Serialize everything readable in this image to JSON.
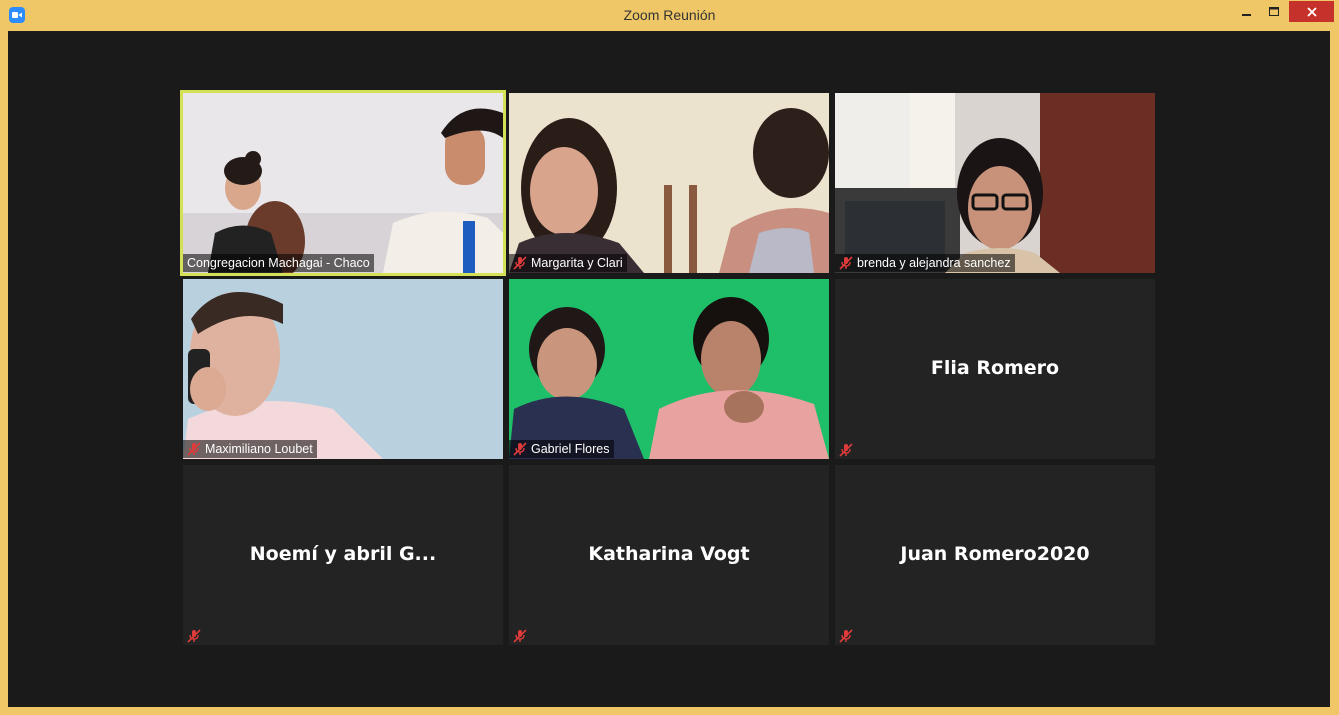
{
  "window": {
    "title": "Zoom Reunión"
  },
  "icons": {
    "app": "zoom-camera-icon",
    "muted": "microphone-muted-icon"
  },
  "colors": {
    "window_frame": "#f0c766",
    "meeting_background": "#1a1a1a",
    "tile_background": "#232323",
    "active_speaker_border": "#d4e157",
    "mute_icon": "#e03b3b"
  },
  "participants": [
    {
      "name": "Congregacion Machagai - Chaco",
      "muted": false,
      "video": true,
      "active_speaker": true
    },
    {
      "name": "Margarita y Clari",
      "muted": true,
      "video": true,
      "active_speaker": false
    },
    {
      "name": "brenda y alejandra sanchez",
      "muted": true,
      "video": true,
      "active_speaker": false
    },
    {
      "name": "Maximiliano Loubet",
      "muted": true,
      "video": true,
      "active_speaker": false
    },
    {
      "name": "Gabriel Flores",
      "muted": true,
      "video": true,
      "active_speaker": false
    },
    {
      "name": "Flia Romero",
      "muted": true,
      "video": false,
      "active_speaker": false
    },
    {
      "name": "Noemí y abril G...",
      "muted": true,
      "video": false,
      "active_speaker": false
    },
    {
      "name": "Katharina Vogt",
      "muted": true,
      "video": false,
      "active_speaker": false
    },
    {
      "name": "Juan Romero2020",
      "muted": true,
      "video": false,
      "active_speaker": false
    }
  ]
}
